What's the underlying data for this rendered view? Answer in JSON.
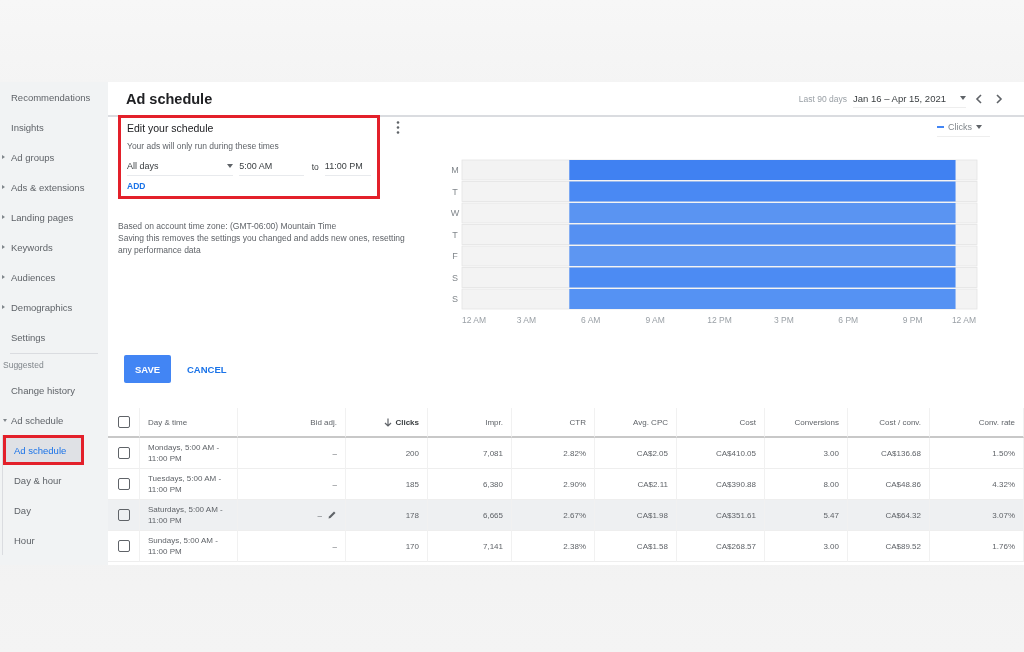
{
  "page_title": "Ad schedule",
  "date_range": {
    "label": "Last 90 days",
    "value": "Jan 16 – Apr 15, 2021"
  },
  "sidebar": {
    "items": [
      {
        "label": "Recommendations",
        "expandable": false
      },
      {
        "label": "Insights",
        "expandable": false
      },
      {
        "label": "Ad groups",
        "expandable": true,
        "expanded": false
      },
      {
        "label": "Ads & extensions",
        "expandable": true,
        "expanded": false
      },
      {
        "label": "Landing pages",
        "expandable": true,
        "expanded": false
      },
      {
        "label": "Keywords",
        "expandable": true,
        "expanded": false
      },
      {
        "label": "Audiences",
        "expandable": true,
        "expanded": false
      },
      {
        "label": "Demographics",
        "expandable": true,
        "expanded": false
      },
      {
        "label": "Settings",
        "expandable": false
      }
    ],
    "section": "Suggested",
    "suggested": [
      {
        "label": "Change history",
        "expandable": false
      },
      {
        "label": "Ad schedule",
        "expandable": true,
        "expanded": true,
        "children": [
          {
            "label": "Ad schedule",
            "selected": true,
            "highlighted": true
          },
          {
            "label": "Day & hour",
            "selected": false,
            "highlighted": false
          },
          {
            "label": "Day",
            "selected": false,
            "highlighted": false
          },
          {
            "label": "Hour",
            "selected": false,
            "highlighted": false
          }
        ]
      }
    ]
  },
  "schedule": {
    "title": "Edit your schedule",
    "highlighted": true,
    "subtitle": "Your ads will only run during these times",
    "rows": [
      {
        "days": "All days",
        "from": "5:00 AM",
        "to_label": "to",
        "to": "11:00 PM"
      }
    ],
    "add": "ADD",
    "notes": [
      "Based on account time zone: (GMT-06:00) Mountain Time",
      "Saving this removes the settings you changed and adds new ones, resetting any performance data"
    ]
  },
  "buttons": {
    "save": "SAVE",
    "cancel": "CANCEL"
  },
  "chart": {
    "legend": "Clicks",
    "days": [
      {
        "label": "M",
        "color": "#4081f2"
      },
      {
        "label": "T",
        "color": "#4a89f3"
      },
      {
        "label": "W",
        "color": "#5a94f2"
      },
      {
        "label": "T",
        "color": "#5590f2"
      },
      {
        "label": "F",
        "color": "#5d96f2"
      },
      {
        "label": "S",
        "color": "#4c8bf3"
      },
      {
        "label": "S",
        "color": "#5592f3"
      }
    ],
    "x_labels": [
      "12 AM",
      "3 AM",
      "6 AM",
      "9 AM",
      "12 PM",
      "3 PM",
      "6 PM",
      "9 PM",
      "12 AM"
    ]
  },
  "table": {
    "all_checked": false,
    "columns": [
      {
        "label": "Day & time",
        "sorted": false
      },
      {
        "label": "Bid adj.",
        "sorted": false
      },
      {
        "label": "Clicks",
        "sorted": true
      },
      {
        "label": "Impr.",
        "sorted": false
      },
      {
        "label": "CTR",
        "sorted": false
      },
      {
        "label": "Avg. CPC",
        "sorted": false
      },
      {
        "label": "Cost",
        "sorted": false
      },
      {
        "label": "Conversions",
        "sorted": false
      },
      {
        "label": "Cost / conv.",
        "sorted": false
      },
      {
        "label": "Conv. rate",
        "sorted": false
      }
    ],
    "rows": [
      {
        "checked": false,
        "hovered": false,
        "cells": [
          "Mondays, 5:00 AM - 11:00 PM",
          "–",
          "200",
          "7,081",
          "2.82%",
          "CA$2.05",
          "CA$410.05",
          "3.00",
          "CA$136.68",
          "1.50%"
        ]
      },
      {
        "checked": false,
        "hovered": false,
        "cells": [
          "Tuesdays, 5:00 AM - 11:00 PM",
          "–",
          "185",
          "6,380",
          "2.90%",
          "CA$2.11",
          "CA$390.88",
          "8.00",
          "CA$48.86",
          "4.32%"
        ]
      },
      {
        "checked": false,
        "hovered": true,
        "cells": [
          "Saturdays, 5:00 AM - 11:00 PM",
          "–",
          "178",
          "6,665",
          "2.67%",
          "CA$1.98",
          "CA$351.61",
          "5.47",
          "CA$64.32",
          "3.07%"
        ]
      },
      {
        "checked": false,
        "hovered": false,
        "cells": [
          "Sundays, 5:00 AM - 11:00 PM",
          "–",
          "170",
          "7,141",
          "2.38%",
          "CA$1.58",
          "CA$268.57",
          "3.00",
          "CA$89.52",
          "1.76%"
        ]
      }
    ]
  }
}
